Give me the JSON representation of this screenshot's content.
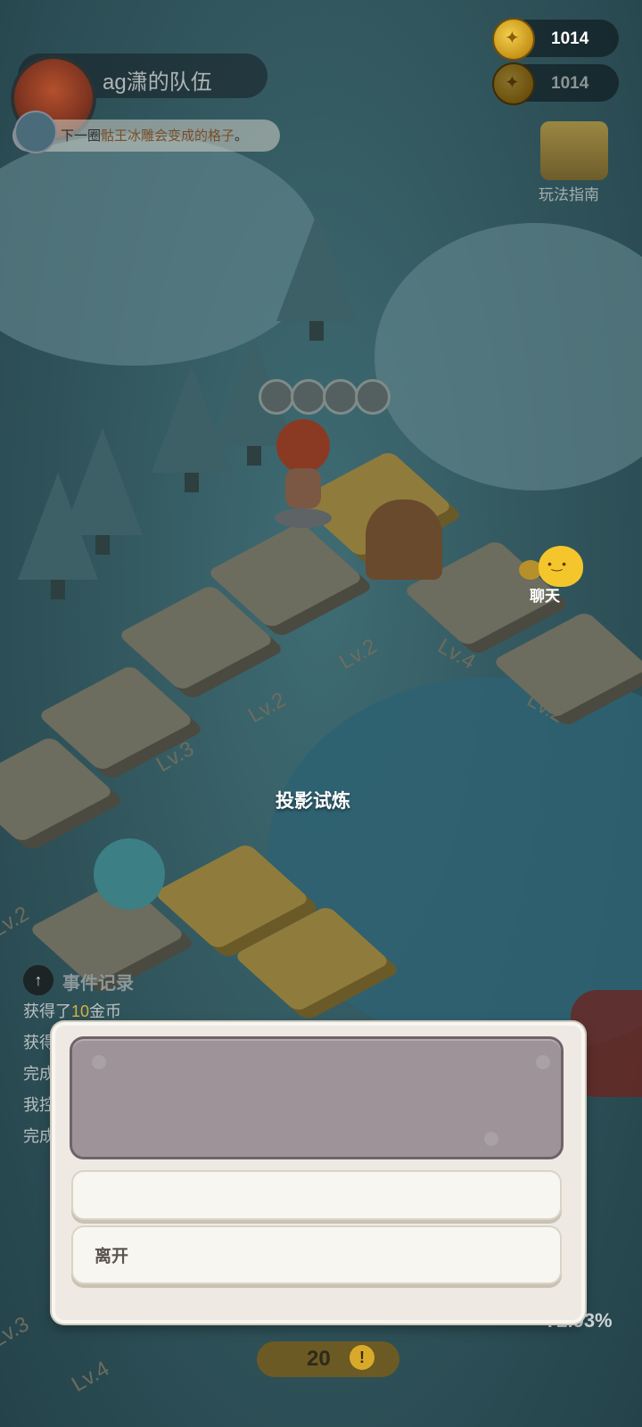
{
  "hud": {
    "team_name": "ag潇的队伍",
    "tip_prefix": "下一圈",
    "tip_highlight": "骷王冰雕会变成的格子",
    "tip_suffix": "。",
    "currency_primary": "1014",
    "currency_secondary": "1014",
    "guide_label": "玩法指南",
    "chat_label": "聊天"
  },
  "board": {
    "location_label": "投影试炼",
    "tile_levels": [
      "Lv.2",
      "Lv.4",
      "Lv.2",
      "Lv.3",
      "Lv.2",
      "Lv.2",
      "Lv.3",
      "Lv.4"
    ]
  },
  "event_log": {
    "title": "事件记录",
    "lines": [
      {
        "prefix": "获得了",
        "number": "10",
        "suffix": "金币"
      },
      {
        "prefix": "获得",
        "number": "",
        "suffix": ""
      },
      {
        "prefix": "完成",
        "number": "",
        "suffix": ""
      },
      {
        "prefix": "我控",
        "number": "",
        "suffix": ""
      },
      {
        "prefix": "完成",
        "number": "",
        "suffix": ""
      }
    ]
  },
  "bottom": {
    "counter": "20",
    "counter_icon": "!",
    "percent": "72.93%"
  },
  "dialog": {
    "option_1": "",
    "option_2": "离开"
  },
  "icons": [
    "avatar-icon",
    "coin-icon",
    "guide-scroll-icon",
    "chat-icon",
    "arrow-up-icon",
    "exclamation-icon"
  ]
}
